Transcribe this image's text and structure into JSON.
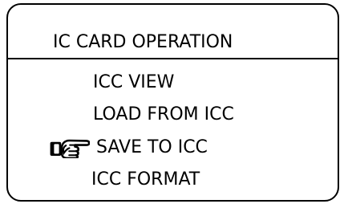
{
  "screen": {
    "title": "IC CARD OPERATION"
  },
  "menu": {
    "selected_index": 2,
    "selection_icon": "pointing-hand-icon",
    "items": [
      {
        "label": "ICC VIEW"
      },
      {
        "label": "LOAD FROM ICC"
      },
      {
        "label": "SAVE TO ICC"
      },
      {
        "label": "ICC FORMAT"
      }
    ]
  }
}
